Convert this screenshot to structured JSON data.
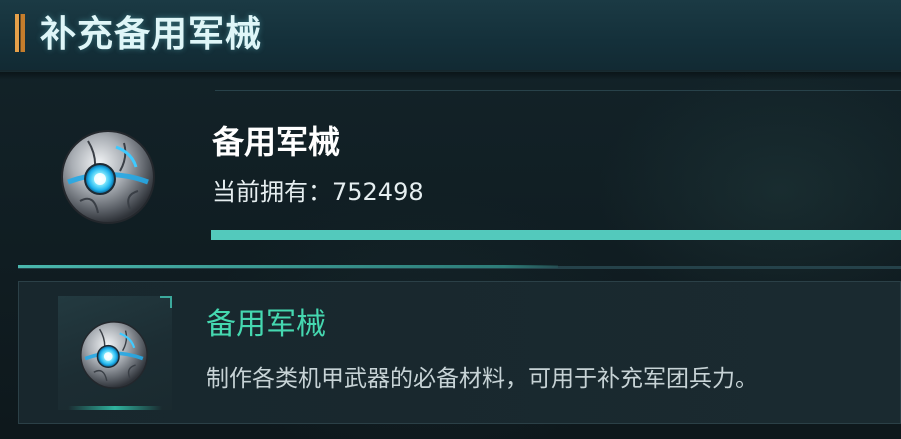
{
  "header": {
    "title": "补充备用军械"
  },
  "item": {
    "name": "备用军械",
    "owned_label": "当前拥有：",
    "owned_value": "752498",
    "progress": 1.0,
    "icon": "mech-core-orb-icon"
  },
  "detail": {
    "name": "备用军械",
    "description": "制作各类机甲武器的必备材料，可用于补充军团兵力。",
    "icon": "mech-core-orb-icon"
  },
  "colors": {
    "accent": "#53c9bc",
    "item_name_green": "#45d8b0",
    "title_stripe": "#e6a04a",
    "orb_glow": "#2fd0ff"
  }
}
